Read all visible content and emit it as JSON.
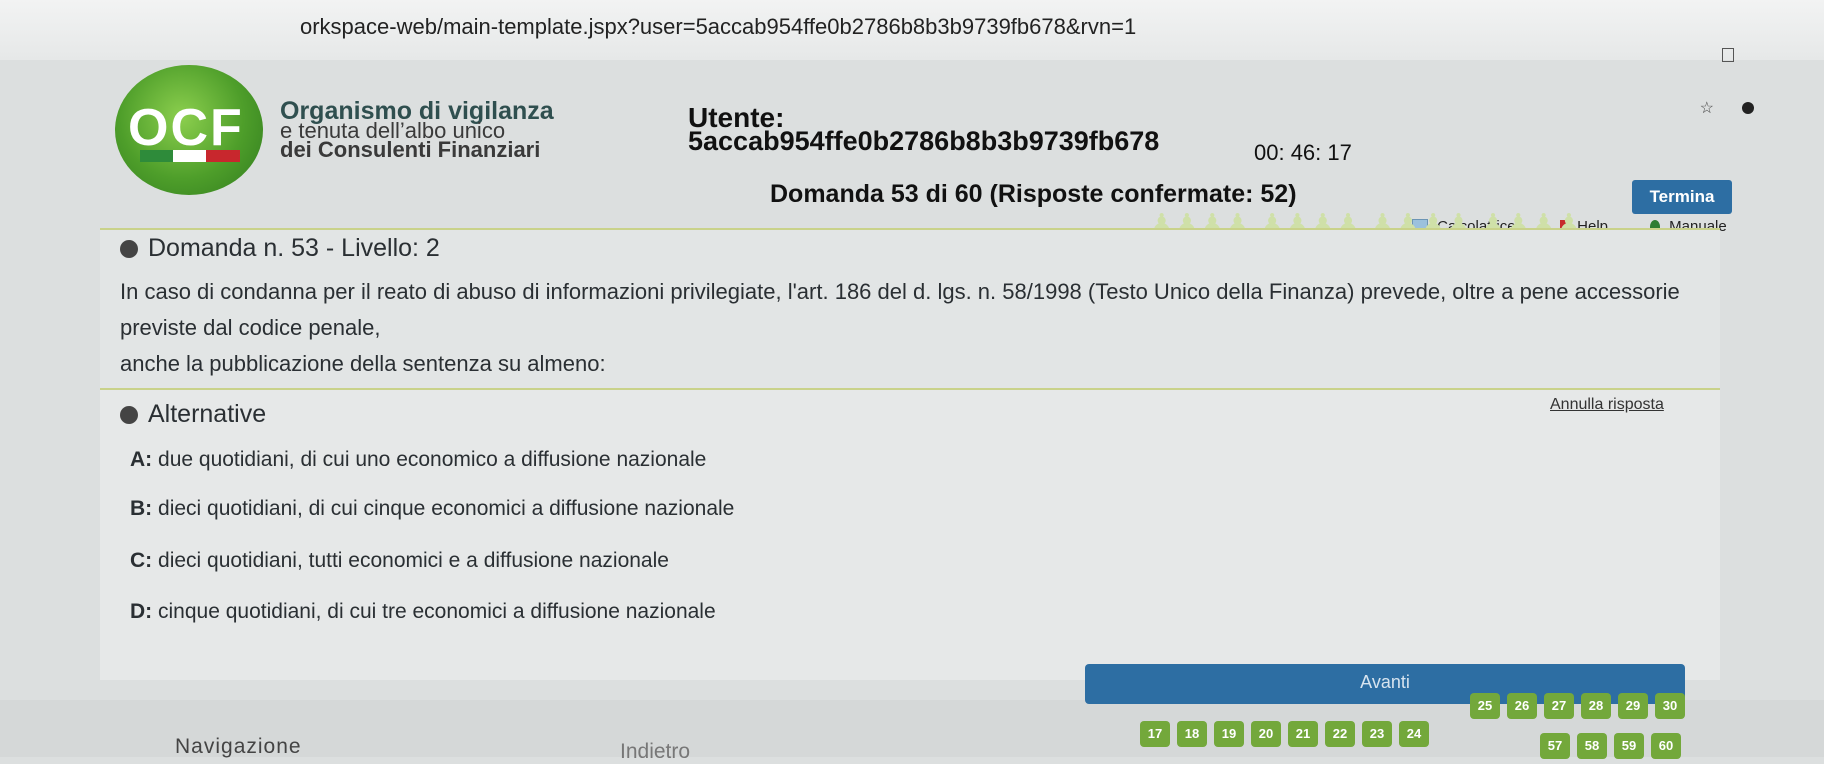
{
  "browser": {
    "url": "orkspace-web/main-template.jspx?user=5accab954ffe0b2786b8b3b9739fb678&rvn=1"
  },
  "header": {
    "logo_text": "OCF",
    "org_line1": "Organismo di vigilanza",
    "org_line2": "e tenuta dell’albo unico",
    "org_line3": "dei Consulenti Finanziari",
    "user_label": "Utente:",
    "user_id": "5accab954ffe0b2786b8b3b9739fb678",
    "timer": "00: 46: 17",
    "question_counter": "Domanda 53 di 60 (Risposte confermate: 52)",
    "termina_label": "Termina",
    "tools": {
      "calcolatrice": "Calcolatrice",
      "help": "Help",
      "manuale": "Manuale"
    }
  },
  "question": {
    "title": "Domanda n. 53 - Livello: 2",
    "text_main": "In caso di condanna per il reato di abuso di informazioni privilegiate, l'art. 186 del d. lgs. n. 58/1998 (Testo Unico della Finanza) prevede, oltre a pene accessorie previste dal codice penale,",
    "text_cont": "anche la pubblicazione della sentenza su almeno:"
  },
  "alternatives": {
    "title": "Alternative",
    "annulla_label": "Annulla risposta",
    "options": [
      {
        "letter": "A:",
        "text": "due quotidiani, di cui uno economico a diffusione nazionale"
      },
      {
        "letter": "B:",
        "text": "dieci quotidiani, di cui cinque economici a diffusione nazionale"
      },
      {
        "letter": "C:",
        "text": "dieci quotidiani, tutti economici e a diffusione nazionale"
      },
      {
        "letter": "D:",
        "text": "cinque quotidiani, di cui tre economici a diffusione nazionale"
      }
    ]
  },
  "navigation": {
    "avanti_label": "Avanti",
    "indietro_label": "Indietro",
    "section_label": "Navigazione",
    "pages_row1": [
      "25",
      "26",
      "27",
      "28",
      "29",
      "30"
    ],
    "pages_row2": [
      "17",
      "18",
      "19",
      "20",
      "21",
      "22",
      "23",
      "24"
    ],
    "pages_row3": [
      "57",
      "58",
      "59",
      "60"
    ]
  },
  "colors": {
    "accent_blue": "#2d6ea3",
    "page_green": "#73a83b",
    "logo_green": "#4e9e2a"
  }
}
